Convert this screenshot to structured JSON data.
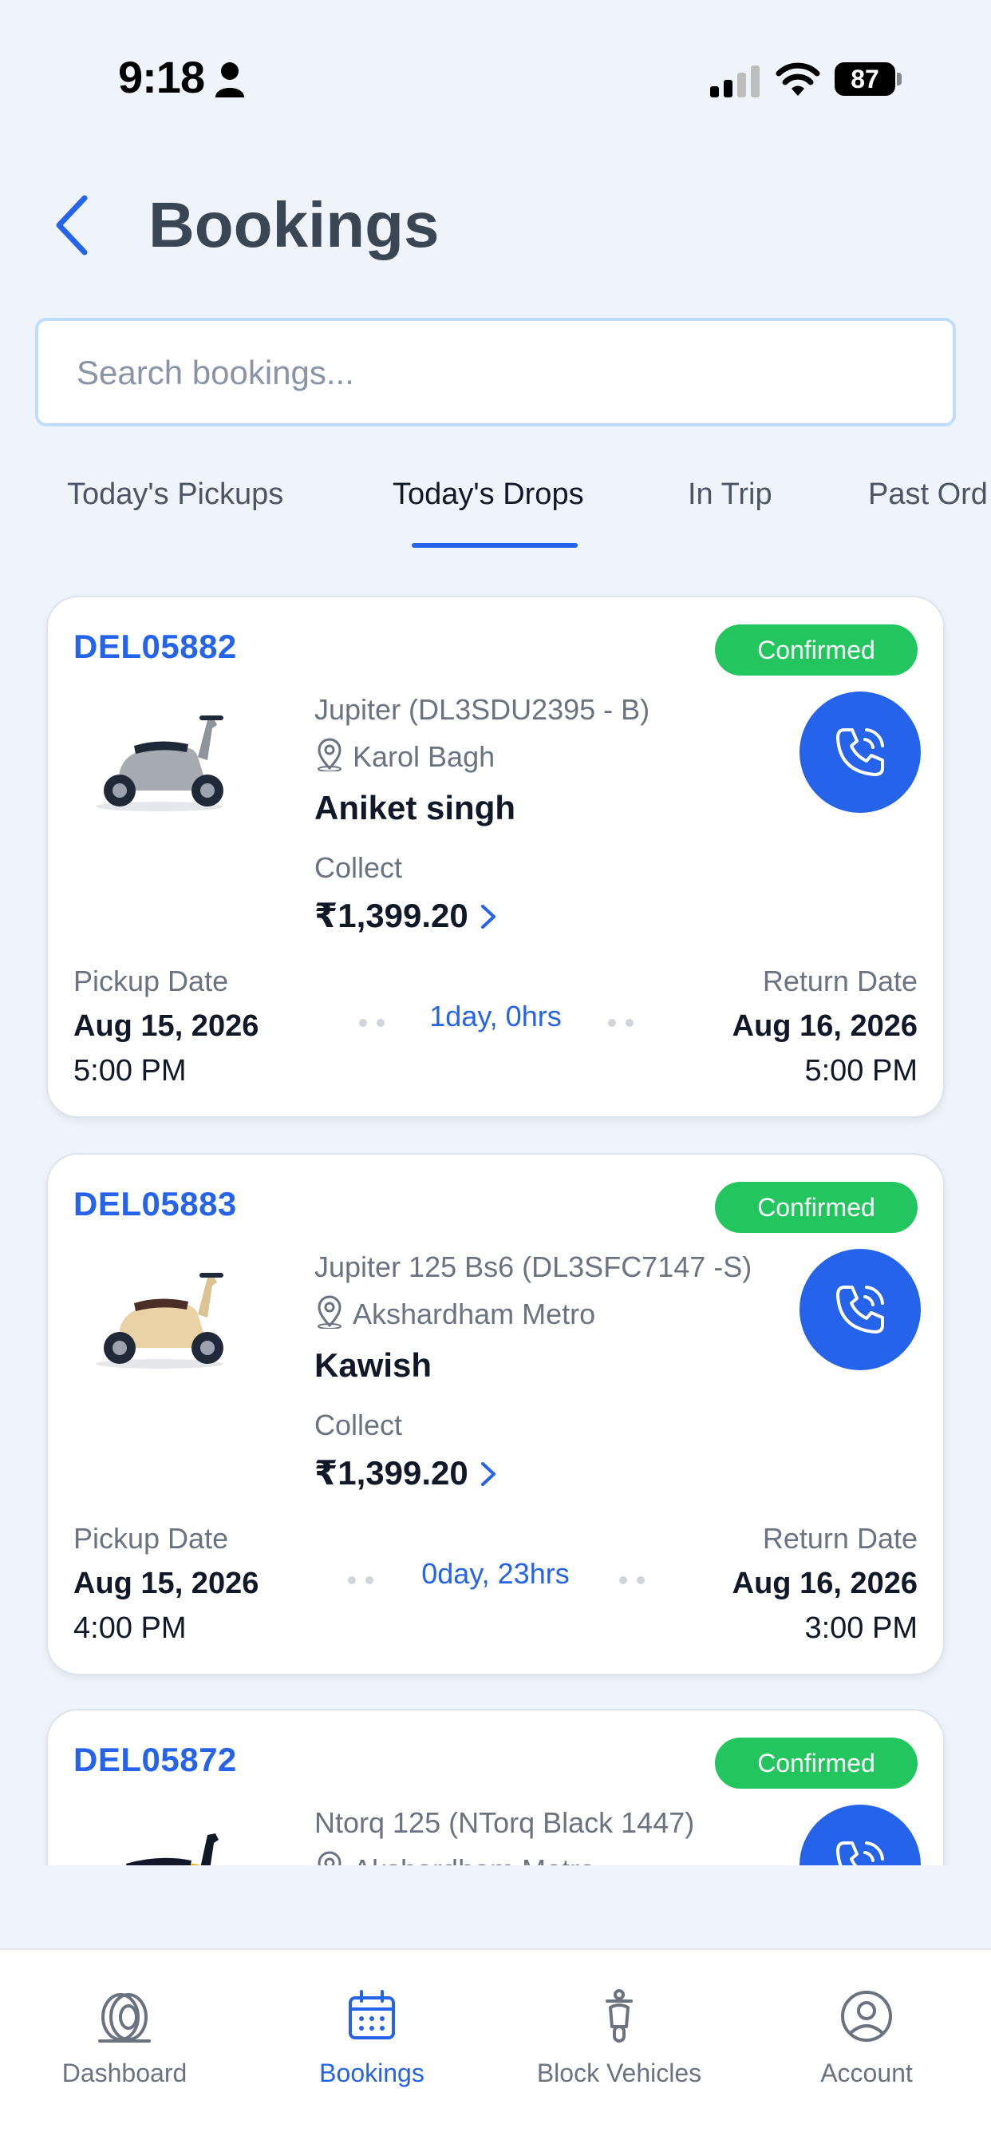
{
  "status_bar": {
    "time": "9:18",
    "battery": "87"
  },
  "header": {
    "title": "Bookings"
  },
  "search": {
    "placeholder": "Search bookings...",
    "value": ""
  },
  "tabs": [
    {
      "label": "Today's Pickups",
      "active": false
    },
    {
      "label": "Today's Drops",
      "active": true
    },
    {
      "label": "In Trip",
      "active": false
    },
    {
      "label": "Past Ord",
      "active": false
    }
  ],
  "bookings": [
    {
      "id": "DEL05882",
      "status": "Confirmed",
      "vehicle": "Jupiter (DL3SDU2395 - B)",
      "location": "Karol Bagh",
      "customer": "Aniket singh",
      "collect_label": "Collect",
      "amount": "₹1,399.20",
      "pickup_label": "Pickup Date",
      "pickup_date": "Aug 15, 2026",
      "pickup_time": "5:00 PM",
      "duration": "1day, 0hrs",
      "return_label": "Return Date",
      "return_date": "Aug 16, 2026",
      "return_time": "5:00 PM",
      "vehicle_color": "silver"
    },
    {
      "id": "DEL05883",
      "status": "Confirmed",
      "vehicle": "Jupiter 125 Bs6 (DL3SFC7147 -S)",
      "location": "Akshardham Metro",
      "customer": "Kawish",
      "collect_label": "Collect",
      "amount": "₹1,399.20",
      "pickup_label": "Pickup Date",
      "pickup_date": "Aug 15, 2026",
      "pickup_time": "4:00 PM",
      "duration": "0day, 23hrs",
      "return_label": "Return Date",
      "return_date": "Aug 16, 2026",
      "return_time": "3:00 PM",
      "vehicle_color": "beige"
    },
    {
      "id": "DEL05872",
      "status": "Confirmed",
      "vehicle": "Ntorq 125 (NTorq Black 1447)",
      "location": "Akshardham Metro",
      "vehicle_color": "yellow"
    }
  ],
  "bottom_nav": [
    {
      "label": "Dashboard",
      "icon": "tire-icon",
      "active": false
    },
    {
      "label": "Bookings",
      "icon": "calendar-icon",
      "active": true
    },
    {
      "label": "Block Vehicles",
      "icon": "scooter-icon",
      "active": false
    },
    {
      "label": "Account",
      "icon": "user-circle-icon",
      "active": false
    }
  ],
  "colors": {
    "accent": "#2563EB",
    "confirmed": "#22C55E",
    "background": "#EFF4FB"
  }
}
